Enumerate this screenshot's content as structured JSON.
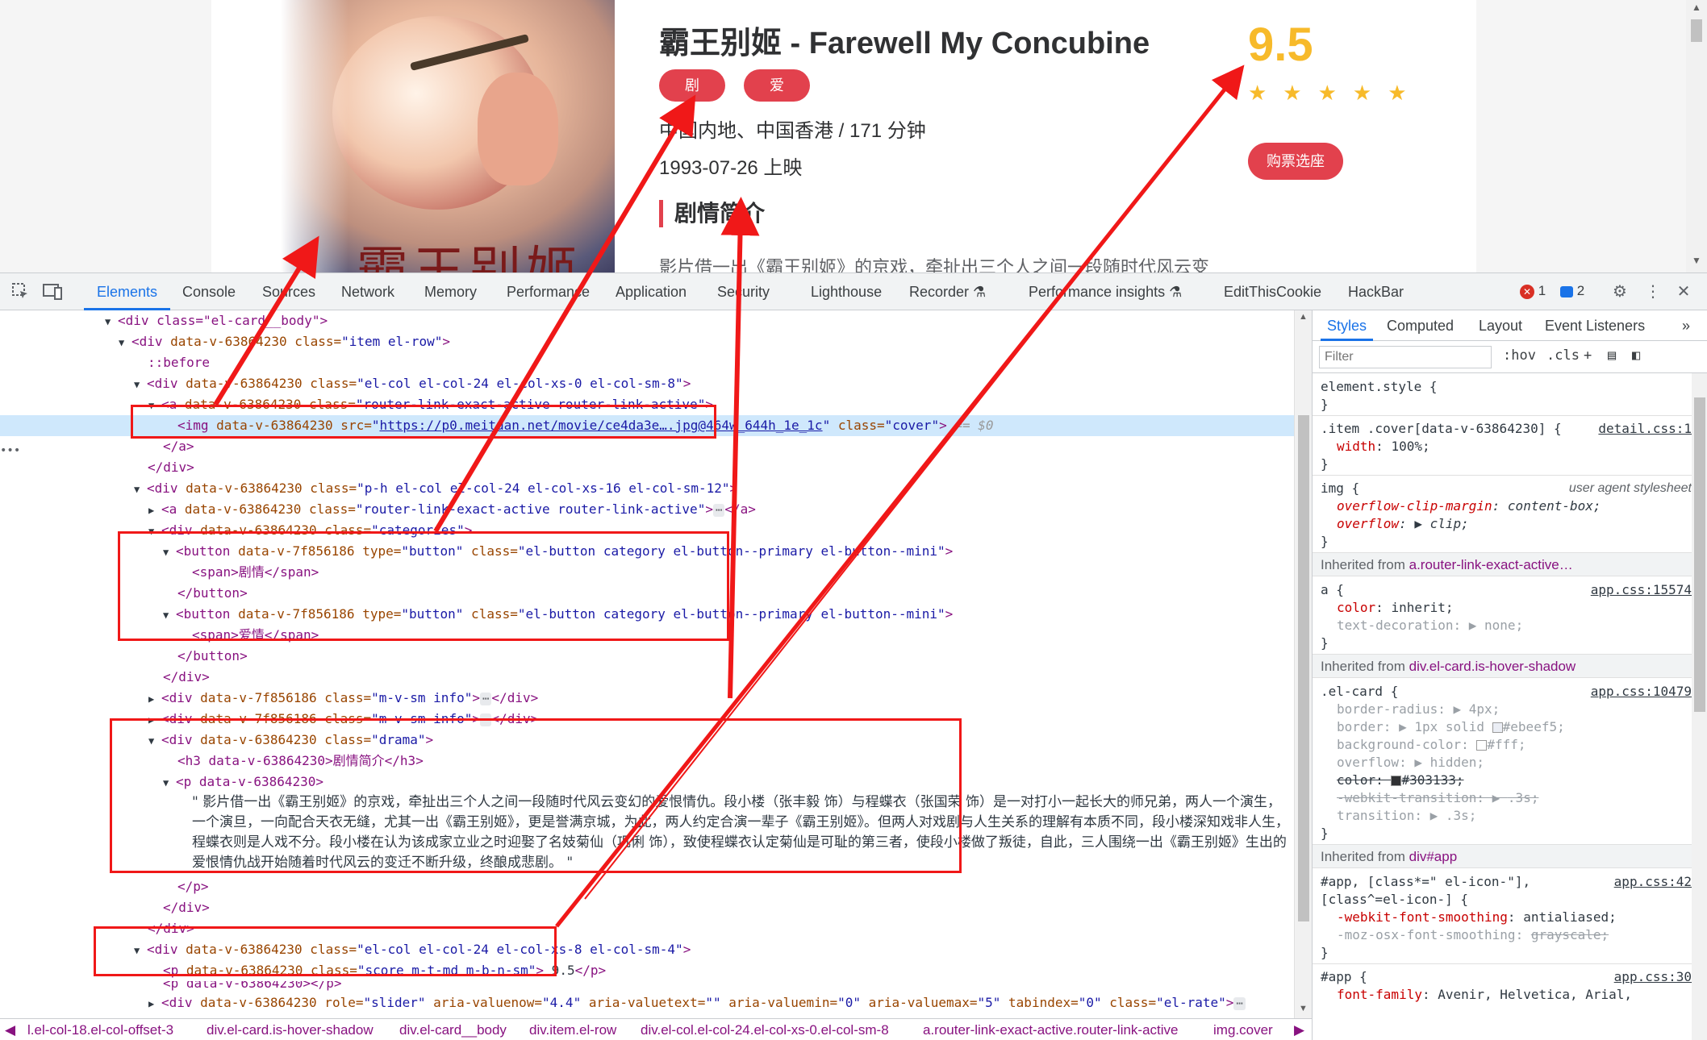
{
  "movie": {
    "title": "霸王别姬 - Farewell My Concubine",
    "tags": [
      "剧情",
      "爱情"
    ],
    "info_region_duration": "中国内地、中国香港 / 171 分钟",
    "info_release": "1993-07-26 上映",
    "drama_heading": "剧情简介",
    "drama_preview": "影片借一出《霸王别姬》的京戏，牵扯出三个人之间一段随时代风云变",
    "score": "9.5",
    "stars": "★★★★★",
    "buy_label": "购票选座",
    "poster_calligraphy": "霸王别姬"
  },
  "devtools": {
    "tabs": [
      "Elements",
      "Console",
      "Sources",
      "Network",
      "Memory",
      "Performance",
      "Application",
      "Security",
      "Lighthouse",
      "Recorder",
      "Performance insights",
      "EditThisCookie",
      "HackBar"
    ],
    "active_tab": "Elements",
    "error_count": "1",
    "message_count": "2",
    "icons": [
      "inspect-icon",
      "device-toolbar-icon",
      "settings-icon",
      "more-icon",
      "close-icon"
    ]
  },
  "dom": {
    "l01": "<div class=\"el-card__body\">",
    "l02_tag": "<div ",
    "l02_attr1": "data-v-63864230",
    "l02_attr2n": " class=",
    "l02_attr2v": "\"item el-row\"",
    "l03": "::before",
    "l04_attr2v": "\"el-col el-col-24 el-col-xs-0 el-col-sm-8\"",
    "l05_tag": "<a ",
    "l05_attr2v": "\"router-link-exact-active router-link-active\"",
    "l06_tag": "<img ",
    "l06_src_name": " src=",
    "l06_src": "https://p0.meituan.net/movie/ce4da3e….jpg@464w_644h_1e_1c",
    "l06_cls": "\"cover\"",
    "l06_eq": "== $0",
    "l07": "</a>",
    "l08": "</div>",
    "l09_attr2v": "\"p-h el-col el-col-24 el-col-xs-16 el-col-sm-12\"",
    "l10_attr2v": "\"router-link-exact-active router-link-active\"",
    "l11_attr2v": "\"categories\"",
    "btn_tag": "<button ",
    "btn_attr1": "data-v-7f856186",
    "btn_type_n": " type=",
    "btn_type_v": "\"button\"",
    "btn_cls_v": "\"el-button category el-button--primary el-button--mini\"",
    "span1": "<span>剧情</span>",
    "btn_close": "</button>",
    "span2": "<span>爱情</span>",
    "info_cls": "\"m-v-sm info\"",
    "drama_cls": "\"drama\"",
    "h3_line": "<h3 data-v-63864230>剧情简介</h3>",
    "p_open": "<p data-v-63864230>",
    "drama_full": "\" 影片借一出《霸王别姬》的京戏，牵扯出三个人之间一段随时代风云变幻的爱恨情仇。段小楼（张丰毅 饰）与程蝶衣（张国荣 饰）是一对打小一起长大的师兄弟，两人一个演生，一个演旦，一向配合天衣无缝，尤其一出《霸王别姬》，更是誉满京城，为此，两人约定合演一辈子《霸王别姬》。但两人对戏剧与人生关系的理解有本质不同，段小楼深知戏非人生，程蝶衣则是人戏不分。段小楼在认为该成家立业之时迎娶了名妓菊仙（巩俐 饰），致使程蝶衣认定菊仙是可耻的第三者，使段小楼做了叛徒，自此，三人围绕一出《霸王别姬》生出的爱恨情仇战开始随着时代风云的变迁不断升级，终酿成悲剧。 \"",
    "p_close": "</p>",
    "col8_cls": "\"el-col el-col-24 el-col-xs-8 el-col-sm-4\"",
    "score_p_tag": "<p ",
    "score_p_cls": "\"score m-t-md m-b-n-sm\"",
    "score_val": " 9.5",
    "score_p_end": "</p>",
    "p_partial": "<p data-v-63864230></p>",
    "rate_role_v": "\"slider\"",
    "rate_now_v": "\"4.4\"",
    "rate_text_v": "\"\"",
    "rate_min_v": "\"0\"",
    "rate_max_v": "\"5\"",
    "rate_tab_v": "\"0\"",
    "rate_cls_v": "\"el-rate\"",
    "gutter": "•••"
  },
  "breadcrumbs": [
    "l.el-col-18.el-col-offset-3",
    "div.el-card.is-hover-shadow",
    "div.el-card__body",
    "div.item.el-row",
    "div.el-col.el-col-24.el-col-xs-0.el-col-sm-8",
    "a.router-link-exact-active.router-link-active",
    "img.cover"
  ],
  "styles": {
    "tabs": [
      "Styles",
      "Computed",
      "Layout",
      "Event Listeners"
    ],
    "filter_placeholder": "Filter",
    "hov": ":hov",
    "cls": ".cls",
    "r1_sel": "element.style {",
    "r2_sel": ".item .cover[data-v-63864230] {",
    "r2_src": "detail.css:1",
    "r2_p1n": "width",
    "r2_p1v": "100%;",
    "r3_sel": "img {",
    "r3_ua": "user agent stylesheet",
    "r3_p1n": "overflow-clip-margin",
    "r3_p1v": "content-box;",
    "r3_p2n": "overflow",
    "r3_p2v": "clip;",
    "inh1_label": "Inherited from ",
    "inh1_sel": "a.router-link-exact-active…",
    "r4_sel": "a {",
    "r4_src": "app.css:15574",
    "r4_p1n": "color",
    "r4_p1v": "inherit;",
    "r4_p2n": "text-decoration",
    "r4_p2v": "none;",
    "inh2_sel": "div.el-card.is-hover-shadow",
    "r5_sel": ".el-card {",
    "r5_src": "app.css:10479",
    "r5_p1n": "border-radius",
    "r5_p1v": "4px;",
    "r5_p2n": "border",
    "r5_p2v": "1px solid ",
    "r5_p2c": "#ebeef5;",
    "r5_p3n": "background-color",
    "r5_p3v": "#fff;",
    "r5_p4n": "overflow",
    "r5_p4v": "hidden;",
    "r5_p5n": "color",
    "r5_p5v": "#303133;",
    "r5_p6n": "-webkit-transition",
    "r5_p6v": ".3s;",
    "r5_p7n": "transition",
    "r5_p7v": ".3s;",
    "inh3_sel": "div#app",
    "r6_sel1": "#app, [class*=\" el-icon-\"],",
    "r6_sel2": "[class^=el-icon-] {",
    "r6_src": "app.css:42",
    "r6_p1n": "-webkit-font-smoothing",
    "r6_p1v": "antialiased;",
    "r6_p2n": "-moz-osx-font-smoothing",
    "r6_p2v": "grayscale;",
    "r7_sel": "#app {",
    "r7_src": "app.css:30",
    "r7_p1n": "font-family",
    "r7_p1v": "Avenir, Helvetica, Arial,",
    "close": "}"
  },
  "colors": {
    "accent_red": "#e2414d",
    "score_gold": "#f7ba2a",
    "annotation_red": "#f01818",
    "devtools_blue": "#1a73e8"
  }
}
